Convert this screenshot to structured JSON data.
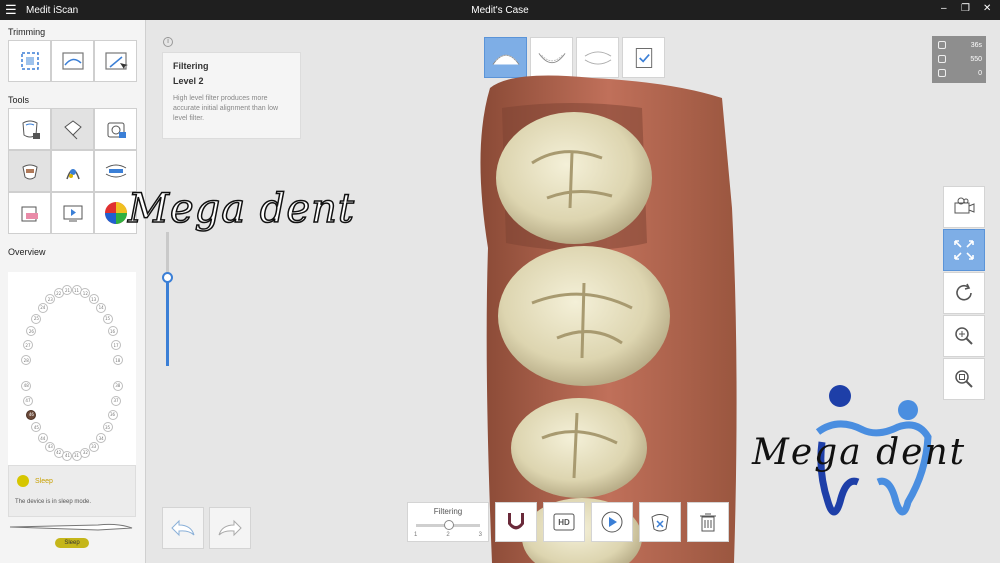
{
  "titlebar": {
    "menu_icon": "hamburger-icon",
    "app_name": "Medit iScan",
    "case_title": "Medit's Case",
    "minimize": "–",
    "maximize": "❐",
    "close": "✕"
  },
  "sidebar": {
    "trimming_label": "Trimming",
    "tools_label": "Tools",
    "overview_label": "Overview",
    "trimming_tools": [
      "trim-box-icon",
      "trim-lasso-icon",
      "trim-select-icon"
    ],
    "tools": [
      "tooth-lock-icon",
      "eraser-icon",
      "camera-settings-icon",
      "tooth-color-icon",
      "tooth-marker-icon",
      "bite-align-icon",
      "tooth-section-icon",
      "video-icon",
      "color-wheel-icon"
    ],
    "teeth_upper": [
      "11",
      "12",
      "13",
      "14",
      "15",
      "16",
      "17",
      "18",
      "21",
      "22",
      "23",
      "24",
      "25",
      "26",
      "27",
      "28"
    ],
    "teeth_lower": [
      "31",
      "32",
      "33",
      "34",
      "35",
      "36",
      "37",
      "38",
      "41",
      "42",
      "43",
      "44",
      "45",
      "46",
      "47",
      "48"
    ],
    "active_tooth": "46",
    "sleep": {
      "title": "Sleep",
      "message": "The device is in sleep mode.",
      "button": "Sleep"
    }
  },
  "filter_card": {
    "info_icon": "i",
    "title": "Filtering",
    "level": "Level 2",
    "description": "High level filter produces more accurate initial alignment than low level filter."
  },
  "stage_tabs": [
    {
      "name": "maxilla-stage",
      "icon": "upper-jaw-icon",
      "active": true
    },
    {
      "name": "mandible-stage",
      "icon": "lower-jaw-icon",
      "active": false
    },
    {
      "name": "occlusion-stage",
      "icon": "bite-icon",
      "active": false
    },
    {
      "name": "checklist-stage",
      "icon": "checklist-icon",
      "active": false
    }
  ],
  "stats": {
    "time": "36s",
    "count": "550",
    "rescan": "0"
  },
  "right_tools": [
    "camera-icon",
    "fit-screen-icon",
    "rotate-icon",
    "zoom-icon",
    "zoom-fit-icon"
  ],
  "bottom": {
    "filter_label": "Filtering",
    "filter_ticks": [
      "1",
      "2",
      "3"
    ],
    "filter_level": 2,
    "hd_label": "HD"
  },
  "watermark": {
    "text1": "Mega dent",
    "text2": "Mega dent"
  },
  "colors": {
    "accent": "#7eaee6",
    "slider": "#3b7fd6",
    "gum": "#b8644a",
    "tooth": "#e8e2c4"
  }
}
